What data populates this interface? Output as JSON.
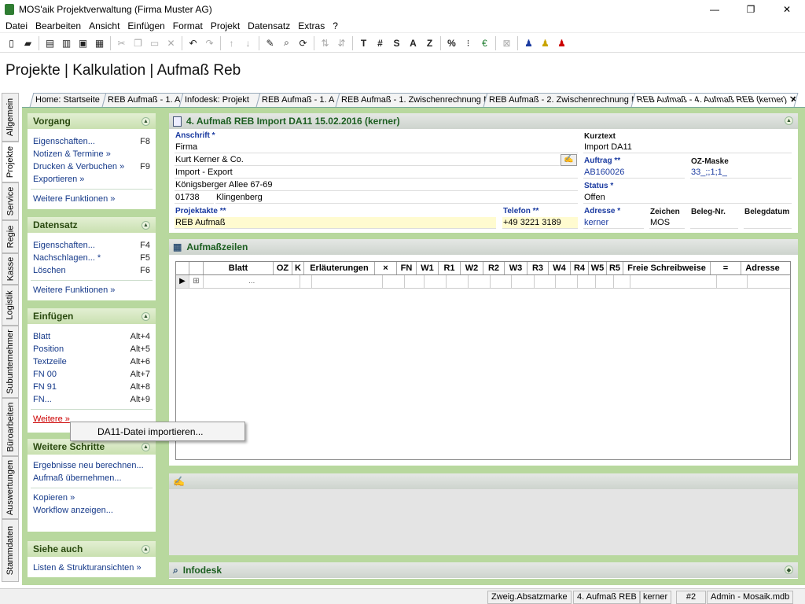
{
  "window": {
    "title": "MOS'aik Projektverwaltung (Firma Muster AG)",
    "minimize": "—",
    "maximize": "❐",
    "close": "✕"
  },
  "menu": [
    "Datei",
    "Bearbeiten",
    "Ansicht",
    "Einfügen",
    "Format",
    "Projekt",
    "Datensatz",
    "Extras",
    "?"
  ],
  "toolbar": {
    "text_buttons": [
      "T",
      "#",
      "S",
      "A",
      "Z"
    ]
  },
  "page_title": "Projekte | Kalkulation | Aufmaß Reb",
  "vtabs": [
    "Allgemein",
    "Projekte",
    "Service",
    "Regie",
    "Kasse",
    "Logistik",
    "Subunternehmer",
    "Büroarbeiten",
    "Auswertungen",
    "Stammdaten"
  ],
  "tabs": [
    "Home: Startseite",
    "REB Aufmaß - 1. A",
    "Infodesk: Projekt",
    "REB Aufmaß - 1. A",
    "REB Aufmaß - 1. Zwischenrechnung M",
    "REB Aufmaß - 2. Zwischenrechnung M",
    "REB Aufmaß - 4. Aufmaß REB (kerner)"
  ],
  "tab_close": "✕",
  "sidebar": {
    "vorgang": {
      "title": "Vorgang",
      "items": [
        {
          "label": "Eigenschaften...",
          "key": "F8"
        },
        {
          "label": "Notizen & Termine »",
          "key": ""
        },
        {
          "label": "Drucken & Verbuchen »",
          "key": "F9"
        },
        {
          "label": "Exportieren »",
          "key": ""
        }
      ],
      "more": "Weitere Funktionen »"
    },
    "datensatz": {
      "title": "Datensatz",
      "items": [
        {
          "label": "Eigenschaften...",
          "key": "F4"
        },
        {
          "label": "Nachschlagen... *",
          "key": "F5"
        },
        {
          "label": "Löschen",
          "key": "F6"
        }
      ],
      "more": "Weitere Funktionen »"
    },
    "einfuegen": {
      "title": "Einfügen",
      "items": [
        {
          "label": "Blatt",
          "key": "Alt+4"
        },
        {
          "label": "Position",
          "key": "Alt+5"
        },
        {
          "label": "Textzeile",
          "key": "Alt+6"
        },
        {
          "label": "FN 00",
          "key": "Alt+7"
        },
        {
          "label": "FN 91",
          "key": "Alt+8"
        },
        {
          "label": "FN...",
          "key": "Alt+9"
        }
      ],
      "more": "Weitere »"
    },
    "schritte": {
      "title": "Weitere Schritte",
      "items": [
        {
          "label": "Ergebnisse neu berechnen..."
        },
        {
          "label": "Aufmaß übernehmen..."
        },
        {
          "label": "Kopieren »"
        },
        {
          "label": "Workflow anzeigen..."
        }
      ]
    },
    "siehe": {
      "title": "Siehe auch",
      "items": [
        {
          "label": "Listen & Strukturansichten »"
        }
      ]
    }
  },
  "popup": {
    "label": "DA11-Datei importieren..."
  },
  "header_panel": {
    "title": "4. Aufmaß REB Import DA11 15.02.2016 (kerner)",
    "anschrift_label": "Anschrift *",
    "anschrift": [
      "Firma",
      "Kurt Kerner & Co.",
      "Import - Export",
      "Königsberger Allee 67-69"
    ],
    "plz": "01738",
    "ort": "Klingenberg",
    "projektakte_label": "Projektakte **",
    "projektakte": "REB Aufmaß",
    "telefon_label": "Telefon **",
    "telefon": "+49 3221 3189",
    "kurztext_label": "Kurztext",
    "kurztext": "Import DA11",
    "auftrag_label": "Auftrag **",
    "auftrag": "AB160026",
    "ozmaske_label": "OZ-Maske",
    "ozmaske": "33_;;1;1_",
    "status_label": "Status *",
    "status": "Offen",
    "adresse_label": "Adresse *",
    "adresse": "kerner",
    "zeichen_label": "Zeichen",
    "zeichen": "MOS",
    "belegnr_label": "Beleg-Nr.",
    "belegnr": "",
    "belegdatum_label": "Belegdatum",
    "belegdatum": ""
  },
  "aufmass_panel": {
    "title": "Aufmaßzeilen",
    "columns": [
      "Blatt",
      "OZ",
      "K",
      "Erläuterungen",
      "×",
      "FN",
      "W1",
      "R1",
      "W2",
      "R2",
      "W3",
      "R3",
      "W4",
      "R4",
      "W5",
      "R5",
      "Freie Schreibweise",
      "=",
      "Adresse"
    ],
    "row_placeholder": "..."
  },
  "infodesk_panel": {
    "title": "Infodesk"
  },
  "status": [
    "Zweig.Absatzmarke",
    "4. Aufmaß REB",
    "kerner",
    "#2",
    "Admin - Mosaik.mdb"
  ]
}
